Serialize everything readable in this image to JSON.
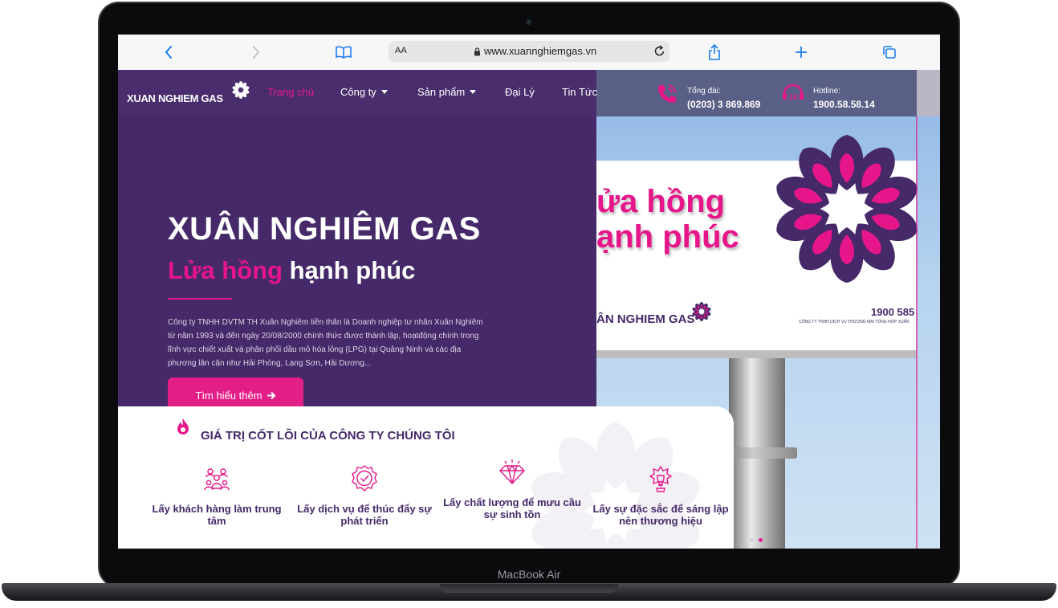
{
  "device": {
    "label": "MacBook Air"
  },
  "browser": {
    "aa_label": "AA",
    "url": "www.xuannghiemgas.vn"
  },
  "nav": {
    "logo_text": "XUAN NGHIEM GAS",
    "items": [
      {
        "label": "Trang chủ",
        "active": true
      },
      {
        "label": "Công ty",
        "dropdown": true
      },
      {
        "label": "Sản phẩm",
        "dropdown": true
      },
      {
        "label": "Đại Lý"
      },
      {
        "label": "Tin Tức"
      }
    ],
    "switchboard": {
      "label": "Tổng đài:",
      "value": "(0203) 3 869.869"
    },
    "hotline": {
      "label": "Hotline:",
      "value": "1900.58.58.14"
    }
  },
  "hero": {
    "title": "XUÂN NGHIÊM GAS",
    "subtitle_pink": "Lửa hồng",
    "subtitle_white": "hạnh phúc",
    "description": "Công ty TNHH DVTM TH Xuân Nghiêm tiền thân là Doanh nghiệp tư nhân Xuân Nghiêm từ năm 1993 và đến ngày 20/08/2000 chính thức được thành lập, hoạtđộng chính trong lĩnh vực chiết xuất và phân phối dầu mỏ hóa lỏng (LPG) tại Quảng Ninh và các địa phương lân cận như Hải Phòng, Lạng Sơn, Hải Dương...",
    "cta_label": "Tìm hiểu thêm"
  },
  "billboard": {
    "line1": "ửa hồng",
    "line2": "ạnh phúc",
    "logo": "ÂN NGHIEM GAS",
    "phone": "1900 585",
    "company": "CÔNG TY TNHH DỊCH VỤ THƯƠNG MẠI TỔNG HỢP XUÂN"
  },
  "core_values": {
    "title": "GIÁ TRỊ CỐT LÕI CỦA CÔNG TY CHÚNG TÔI",
    "items": [
      {
        "label": "Lấy khách hàng làm trung tâm",
        "icon": "customers-icon"
      },
      {
        "label": "Lấy dịch vụ để thúc đẩy sự phát triển",
        "icon": "quality-badge-icon"
      },
      {
        "label": "Lấy chất lượng để mưu cầu sự sinh tồn",
        "icon": "diamond-icon"
      },
      {
        "label": "Lấy sự đặc sắc để sáng lập nên thương hiệu",
        "icon": "award-icon"
      }
    ]
  },
  "slider": {
    "slides": 2,
    "active": 2
  },
  "colors": {
    "brand_purple": "#452969",
    "brand_pink": "#e6168a",
    "cta_pink": "#e41e87",
    "safari_blue": "#1a7cf0"
  }
}
